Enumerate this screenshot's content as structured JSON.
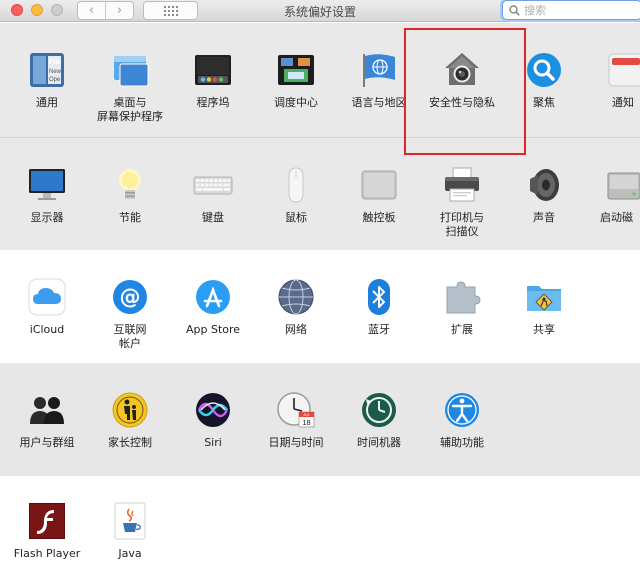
{
  "window": {
    "title": "系统偏好设置"
  },
  "toolbar": {
    "back_label": "‹",
    "forward_label": "›"
  },
  "search": {
    "placeholder": "搜索"
  },
  "rows": [
    [
      {
        "label": "通用",
        "icon": "general-icon"
      },
      {
        "label": "桌面与\n屏幕保护程序",
        "icon": "desktop-screensaver-icon"
      },
      {
        "label": "程序坞",
        "icon": "dock-icon"
      },
      {
        "label": "调度中心",
        "icon": "mission-control-icon"
      },
      {
        "label": "语言与地区",
        "icon": "language-region-icon"
      },
      {
        "label": "安全性与隐私",
        "icon": "security-privacy-icon"
      },
      {
        "label": "聚焦",
        "icon": "spotlight-icon"
      },
      {
        "label": "通知",
        "icon": "notifications-icon"
      }
    ],
    [
      {
        "label": "显示器",
        "icon": "displays-icon"
      },
      {
        "label": "节能",
        "icon": "energy-saver-icon"
      },
      {
        "label": "键盘",
        "icon": "keyboard-icon"
      },
      {
        "label": "鼠标",
        "icon": "mouse-icon"
      },
      {
        "label": "触控板",
        "icon": "trackpad-icon"
      },
      {
        "label": "打印机与\n扫描仪",
        "icon": "printers-scanners-icon"
      },
      {
        "label": "声音",
        "icon": "sound-icon"
      },
      {
        "label": "启动磁",
        "icon": "startup-disk-icon"
      }
    ],
    [
      {
        "label": "iCloud",
        "icon": "icloud-icon"
      },
      {
        "label": "互联网\n帐户",
        "icon": "internet-accounts-icon"
      },
      {
        "label": "App Store",
        "icon": "app-store-icon"
      },
      {
        "label": "网络",
        "icon": "network-icon"
      },
      {
        "label": "蓝牙",
        "icon": "bluetooth-icon"
      },
      {
        "label": "扩展",
        "icon": "extensions-icon"
      },
      {
        "label": "共享",
        "icon": "sharing-icon"
      }
    ],
    [
      {
        "label": "用户与群组",
        "icon": "users-groups-icon"
      },
      {
        "label": "家长控制",
        "icon": "parental-controls-icon"
      },
      {
        "label": "Siri",
        "icon": "siri-icon"
      },
      {
        "label": "日期与时间",
        "icon": "date-time-icon"
      },
      {
        "label": "时间机器",
        "icon": "time-machine-icon"
      },
      {
        "label": "辅助功能",
        "icon": "accessibility-icon"
      }
    ],
    [
      {
        "label": "Flash Player",
        "icon": "flash-player-icon"
      },
      {
        "label": "Java",
        "icon": "java-icon"
      }
    ]
  ],
  "calendar_icon_day": "18",
  "calendar_icon_month": "JUL",
  "colors": {
    "highlight": "#e0262a",
    "search_focus": "#6fa0e8"
  }
}
